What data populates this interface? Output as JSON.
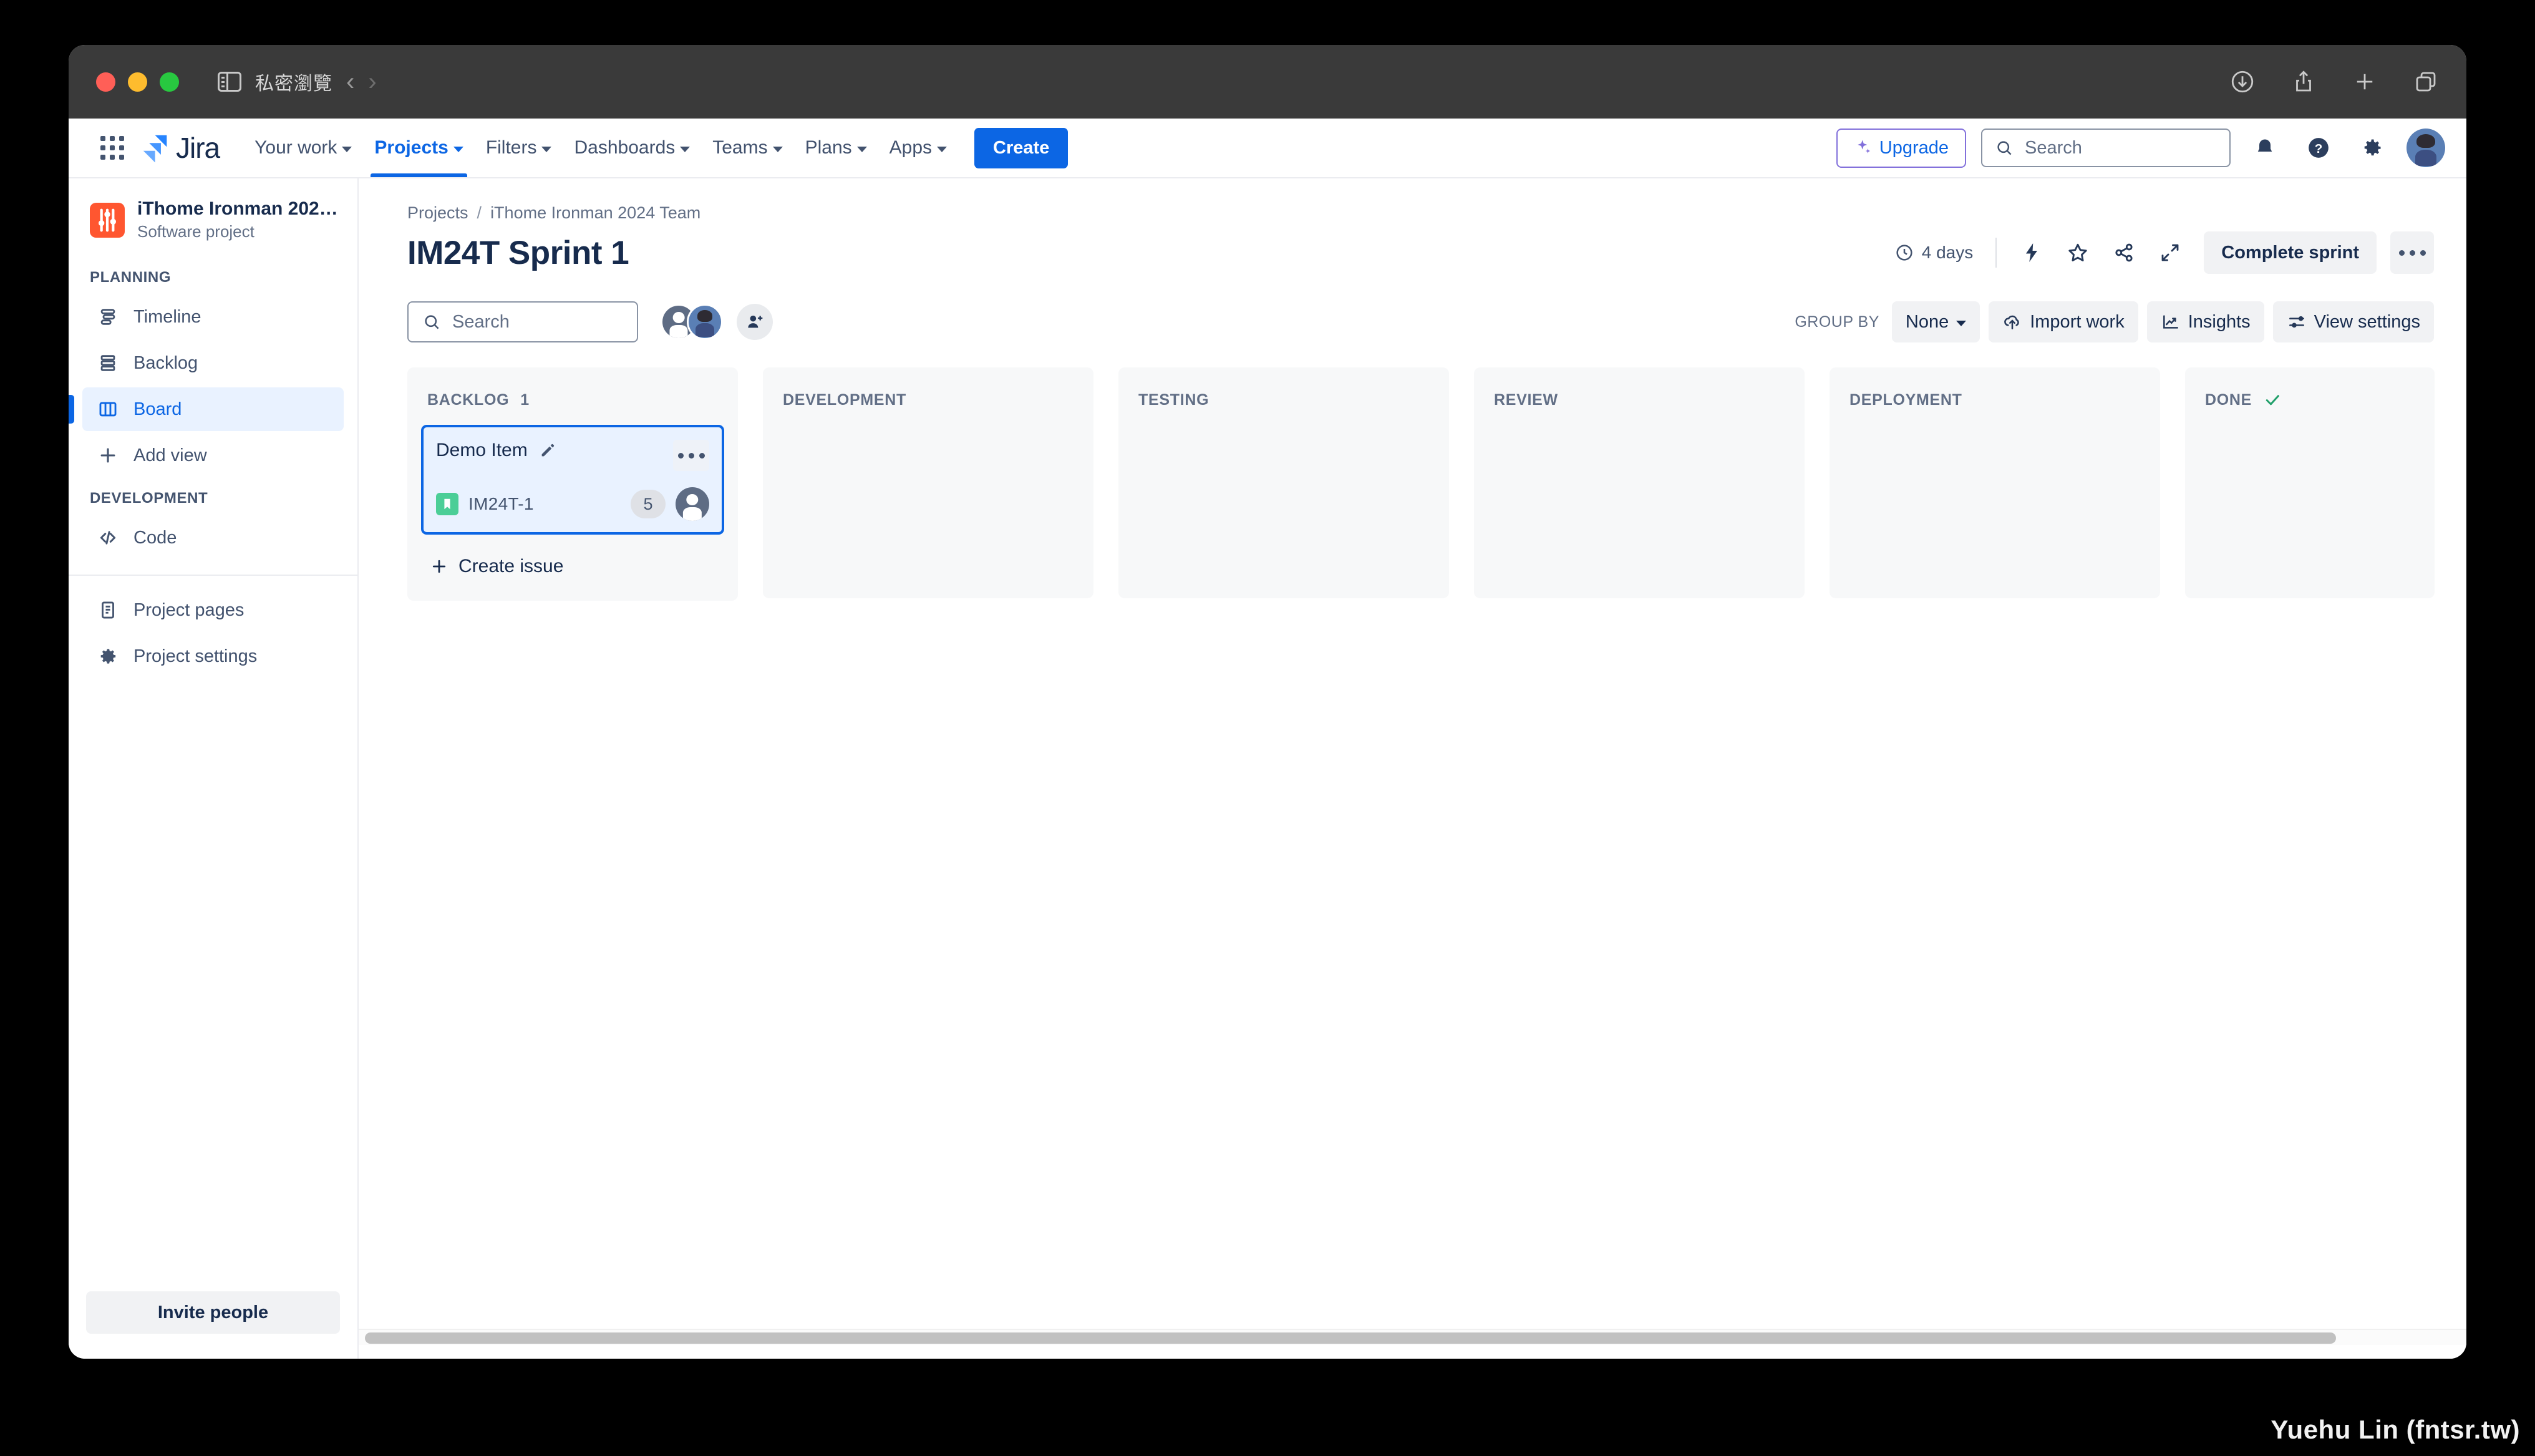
{
  "browser": {
    "private_label": "私密瀏覽",
    "back_icon": "chevron-left-icon",
    "forward_icon": "chevron-right-icon",
    "sidebar_icon": "sidebar-toggle-icon",
    "right_icons": [
      "downloads-icon",
      "share-icon",
      "new-tab-icon",
      "tab-overview-icon"
    ]
  },
  "topnav": {
    "app_switcher_icon": "app-switcher-icon",
    "logo_text": "Jira",
    "links": [
      {
        "label": "Your work",
        "has_caret": true,
        "active": false
      },
      {
        "label": "Projects",
        "has_caret": true,
        "active": true
      },
      {
        "label": "Filters",
        "has_caret": true,
        "active": false
      },
      {
        "label": "Dashboards",
        "has_caret": true,
        "active": false
      },
      {
        "label": "Teams",
        "has_caret": true,
        "active": false
      },
      {
        "label": "Plans",
        "has_caret": true,
        "active": false
      },
      {
        "label": "Apps",
        "has_caret": true,
        "active": false
      }
    ],
    "create_label": "Create",
    "upgrade_label": "Upgrade",
    "search_placeholder": "Search",
    "notifications_icon": "notifications-bell-icon",
    "help_icon": "help-question-icon",
    "settings_icon": "gear-icon",
    "avatar_name": "user-avatar"
  },
  "sidebar": {
    "project_name": "iThome Ironman 2024 ...",
    "project_type": "Software project",
    "project_avatar_icon": "project-sliders-icon",
    "sections": [
      {
        "title": "PLANNING",
        "items": [
          {
            "label": "Timeline",
            "icon": "timeline-icon",
            "selected": false
          },
          {
            "label": "Backlog",
            "icon": "backlog-icon",
            "selected": false
          },
          {
            "label": "Board",
            "icon": "board-columns-icon",
            "selected": true
          },
          {
            "label": "Add view",
            "icon": "plus-icon",
            "selected": false
          }
        ]
      },
      {
        "title": "DEVELOPMENT",
        "items": [
          {
            "label": "Code",
            "icon": "code-brackets-icon",
            "selected": false
          }
        ]
      }
    ],
    "footer_items": [
      {
        "label": "Project pages",
        "icon": "page-document-icon"
      },
      {
        "label": "Project settings",
        "icon": "gear-icon"
      }
    ],
    "invite_label": "Invite people"
  },
  "header": {
    "breadcrumb": [
      "Projects",
      "iThome Ironman 2024 Team"
    ],
    "breadcrumb_separator": "/",
    "title": "IM24T Sprint 1",
    "days_remaining": "4 days",
    "days_icon": "clock-icon",
    "actions": [
      {
        "name": "automation-icon",
        "glyph": "lightning"
      },
      {
        "name": "star-icon",
        "glyph": "star"
      },
      {
        "name": "share-icon",
        "glyph": "share"
      },
      {
        "name": "fullscreen-icon",
        "glyph": "expand"
      }
    ],
    "complete_sprint_label": "Complete sprint",
    "more_actions_icon": "more-horizontal-icon"
  },
  "toolbar": {
    "search_placeholder": "Search",
    "search_icon": "search-icon",
    "avatars": [
      "assignee-avatar-default",
      "assignee-avatar-user"
    ],
    "add_people_icon": "add-person-icon",
    "group_by_label": "GROUP BY",
    "group_by_value": "None",
    "import_work_label": "Import work",
    "import_work_icon": "cloud-upload-icon",
    "insights_label": "Insights",
    "insights_icon": "insights-chart-icon",
    "view_settings_label": "View settings",
    "view_settings_icon": "sliders-icon"
  },
  "board": {
    "columns": [
      {
        "title": "BACKLOG",
        "count": "1",
        "done_check": false,
        "clipped": false,
        "cards": [
          {
            "summary": "Demo Item",
            "edit_icon": "pencil-edit-icon",
            "menu_icon": "more-horizontal-icon",
            "issue_type_icon": "story-bookmark-icon",
            "issue_key": "IM24T-1",
            "story_points": "5",
            "assignee_icon": "assignee-avatar-default",
            "selected": true
          }
        ],
        "create_issue_label": "Create issue",
        "show_create_issue": true
      },
      {
        "title": "DEVELOPMENT",
        "count": "",
        "done_check": false,
        "clipped": false,
        "cards": [],
        "show_create_issue": false
      },
      {
        "title": "TESTING",
        "count": "",
        "done_check": false,
        "clipped": false,
        "cards": [],
        "show_create_issue": false
      },
      {
        "title": "REVIEW",
        "count": "",
        "done_check": false,
        "clipped": false,
        "cards": [],
        "show_create_issue": false
      },
      {
        "title": "DEPLOYMENT",
        "count": "",
        "done_check": false,
        "clipped": false,
        "cards": [],
        "show_create_issue": false
      },
      {
        "title": "DONE",
        "count": "",
        "done_check": true,
        "clipped": true,
        "cards": [],
        "show_create_issue": false
      }
    ]
  },
  "watermark": "Yuehu Lin (fntsr.tw)",
  "colors": {
    "brand_blue": "#0c66e4",
    "selected_card_bg": "#e9f2ff",
    "story_green": "#4bce97",
    "project_orange": "#ff5630",
    "upgrade_purple": "#8270db",
    "text_primary": "#172b4d",
    "text_secondary": "#626f86",
    "column_bg": "#f7f8f9"
  }
}
